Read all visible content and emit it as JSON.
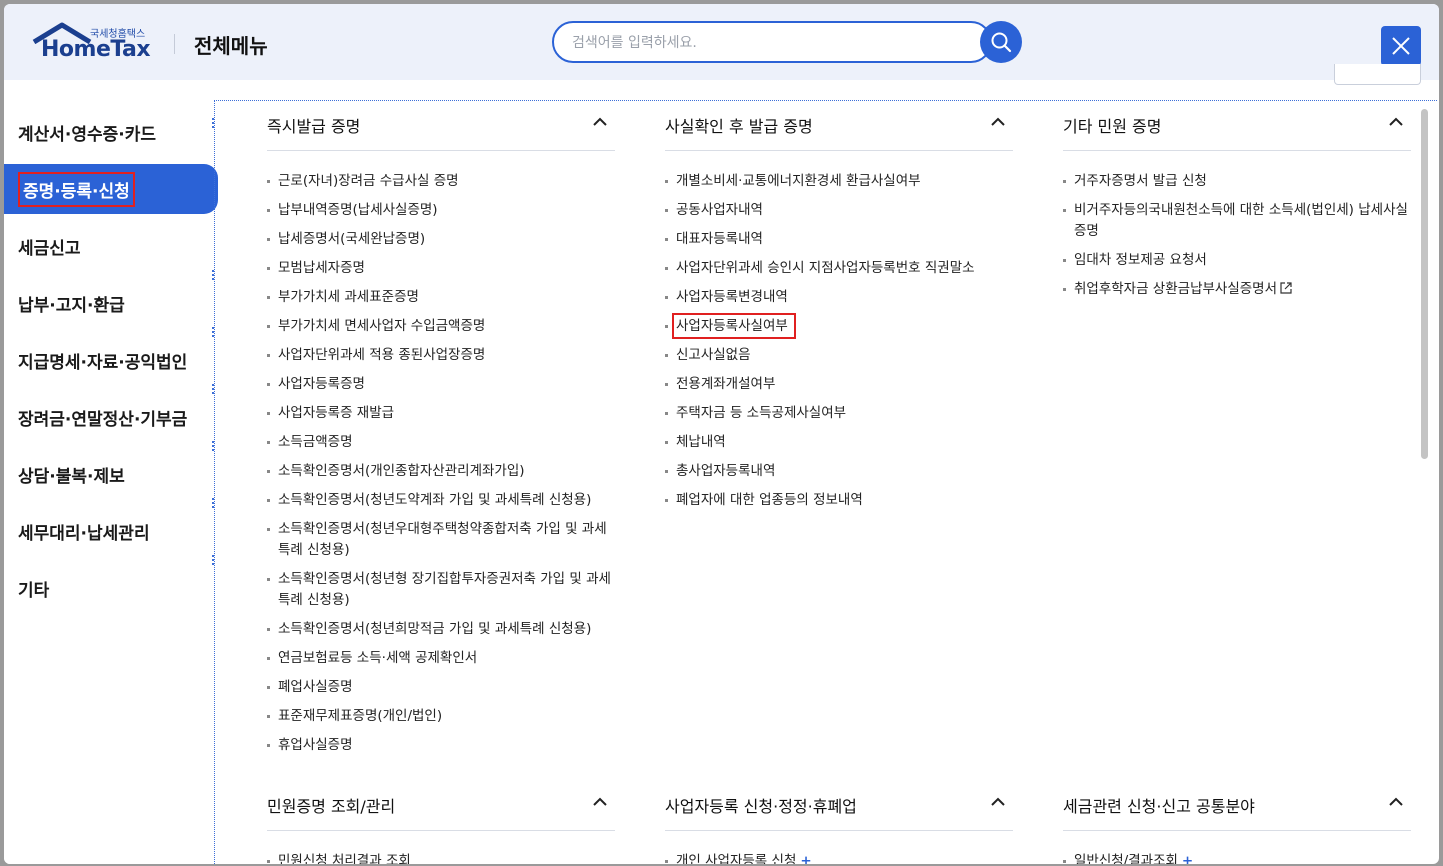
{
  "header": {
    "logo_sub": "국세청홈택스",
    "logo_main": "HomeTax",
    "title": "전체메뉴",
    "search_placeholder": "검색어를 입력하세요."
  },
  "sidebar": {
    "items": [
      {
        "label": "계산서·영수증·카드",
        "active": false
      },
      {
        "label": "증명·등록·신청",
        "active": true
      },
      {
        "label": "세금신고",
        "active": false
      },
      {
        "label": "납부·고지·환급",
        "active": false
      },
      {
        "label": "지급명세·자료·공익법인",
        "active": false
      },
      {
        "label": "장려금·연말정산·기부금",
        "active": false
      },
      {
        "label": "상담·불복·제보",
        "active": false
      },
      {
        "label": "세무대리·납세관리",
        "active": false
      },
      {
        "label": "기타",
        "active": false
      }
    ]
  },
  "sections": [
    {
      "title": "즉시발급 증명",
      "items": [
        "근로(자녀)장려금 수급사실 증명",
        "납부내역증명(납세사실증명)",
        "납세증명서(국세완납증명)",
        "모범납세자증명",
        "부가가치세 과세표준증명",
        "부가가치세 면세사업자 수입금액증명",
        "사업자단위과세 적용 종된사업장증명",
        "사업자등록증명",
        "사업자등록증 재발급",
        "소득금액증명",
        "소득확인증명서(개인종합자산관리계좌가입)",
        "소득확인증명서(청년도약계좌 가입 및 과세특례 신청용)",
        "소득확인증명서(청년우대형주택청약종합저축 가입 및 과세특례 신청용)",
        "소득확인증명서(청년형 장기집합투자증권저축 가입 및 과세특례 신청용)",
        "소득확인증명서(청년희망적금 가입 및 과세특례 신청용)",
        "연금보험료등 소득·세액 공제확인서",
        "폐업사실증명",
        "표준재무제표증명(개인/법인)",
        "휴업사실증명"
      ]
    },
    {
      "title": "사실확인 후 발급 증명",
      "items": [
        "개별소비세·교통에너지환경세 환급사실여부",
        "공동사업자내역",
        "대표자등록내역",
        "사업자단위과세 승인시 지점사업자등록번호 직권말소",
        "사업자등록변경내역",
        "사업자등록사실여부",
        "신고사실없음",
        "전용계좌개설여부",
        "주택자금 등 소득공제사실여부",
        "체납내역",
        "총사업자등록내역",
        "폐업자에 대한 업종등의 정보내역"
      ]
    },
    {
      "title": "기타 민원 증명",
      "items": [
        "거주자증명서 발급 신청",
        "비거주자등의국내원천소득에 대한 소득세(법인세) 납세사실증명",
        "임대차 정보제공 요청서",
        "취업후학자금 상환금납부사실증명서"
      ]
    },
    {
      "title": "민원증명 조회/관리",
      "items": [
        "민원신청 처리결과 조회"
      ]
    },
    {
      "title": "사업자등록 신청·정정·휴폐업",
      "items": [
        "개인 사업자등록 신청"
      ]
    },
    {
      "title": "세금관련 신청·신고 공통분야",
      "items": [
        "일반신청/결과조회"
      ]
    }
  ],
  "colors": {
    "accent": "#2b62d6",
    "highlight": "#e02020"
  },
  "icons": {
    "search": "search-icon",
    "close": "close-icon",
    "collapse": "chevron-up-icon",
    "external": "external-link-icon"
  }
}
